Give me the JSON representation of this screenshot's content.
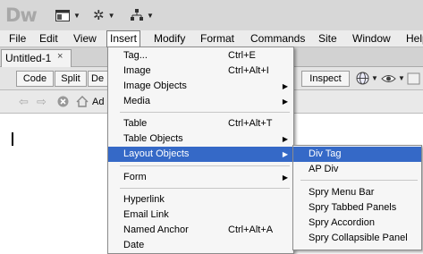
{
  "app": {
    "logo": "Dw",
    "toolbar_icons": [
      "layout-icon",
      "gear-icon",
      "site-icon"
    ]
  },
  "menubar": {
    "items": [
      "File",
      "Edit",
      "View",
      "Insert",
      "Modify",
      "Format",
      "Commands",
      "Site",
      "Window",
      "Help"
    ]
  },
  "document": {
    "tab_label": "Untitled-1",
    "close_glyph": "×",
    "address_partial": "Ad"
  },
  "doc_toolbar": {
    "code": "Code",
    "split": "Split",
    "design_partial": "De",
    "inspect": "Inspect"
  },
  "insert_menu": {
    "items": [
      {
        "label": "Tag...",
        "shortcut": "Ctrl+E"
      },
      {
        "label": "Image",
        "shortcut": "Ctrl+Alt+I"
      },
      {
        "label": "Image Objects",
        "submenu": true
      },
      {
        "label": "Media",
        "submenu": true
      },
      {
        "label": "Table",
        "shortcut": "Ctrl+Alt+T"
      },
      {
        "label": "Table Objects",
        "submenu": true
      },
      {
        "label": "Layout Objects",
        "submenu": true,
        "highlighted": true
      },
      {
        "label": "Form",
        "submenu": true
      },
      {
        "label": "Hyperlink"
      },
      {
        "label": "Email Link"
      },
      {
        "label": "Named Anchor",
        "shortcut": "Ctrl+Alt+A"
      },
      {
        "label": "Date"
      }
    ]
  },
  "layout_submenu": {
    "items": [
      {
        "label": "Div Tag",
        "highlighted": true
      },
      {
        "label": "AP Div"
      },
      {
        "label": "Spry Menu Bar"
      },
      {
        "label": "Spry Tabbed Panels"
      },
      {
        "label": "Spry Accordion"
      },
      {
        "label": "Spry Collapsible Panel"
      }
    ]
  },
  "colors": {
    "highlight": "#3569c7",
    "chrome": "#d7d7d7"
  }
}
